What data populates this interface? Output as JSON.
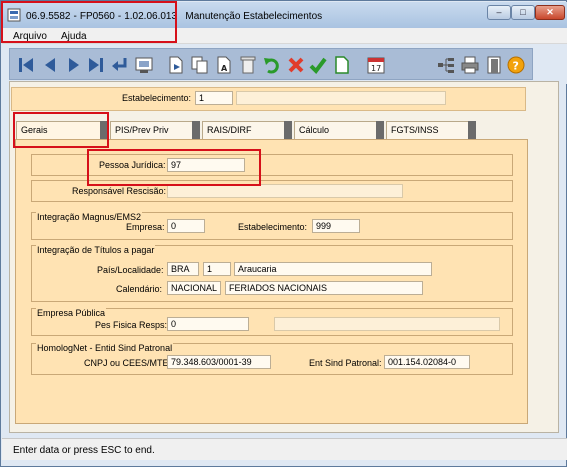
{
  "window": {
    "code": "06.9.5582",
    "program": "FP0560",
    "version": "1.02.06.013",
    "title": "Manutenção Estabelecimentos",
    "buttons": {
      "minimize": "–",
      "maximize": "□",
      "close": "✕"
    }
  },
  "menu": {
    "items": [
      "Arquivo",
      "Ajuda"
    ]
  },
  "toolbar": {
    "icons": [
      "first-record-icon",
      "previous-record-icon",
      "next-record-icon",
      "last-record-icon",
      "go-to-icon",
      "search-icon",
      "new-icon",
      "copy-icon",
      "edit-icon",
      "delete-icon",
      "undo-icon",
      "cancel-icon",
      "save-icon",
      "new-document-icon",
      "calendar-icon",
      "tree-icon",
      "print-icon",
      "exit-icon",
      "help-icon"
    ],
    "calendar_day": "17",
    "help_glyph": "?"
  },
  "header": {
    "estabelecimento_label": "Estabelecimento:",
    "estabelecimento_value": "1"
  },
  "tabs": [
    {
      "label": "Gerais",
      "active": true
    },
    {
      "label": "PIS/Prev Priv"
    },
    {
      "label": "RAIS/DIRF"
    },
    {
      "label": "Cálculo"
    },
    {
      "label": "FGTS/INSS"
    }
  ],
  "gerais": {
    "pessoa_juridica_label": "Pessoa Jurídica:",
    "pessoa_juridica_value": "97",
    "responsavel_label": "Responsável Rescisão:",
    "responsavel_value": "",
    "magnus": {
      "title": "Integração Magnus/EMS2",
      "empresa_label": "Empresa:",
      "empresa_value": "0",
      "estab_label": "Estabelecimento:",
      "estab_value": "999"
    },
    "titulos": {
      "title": "Integração de Títulos a pagar",
      "pais_label": "País/Localidade:",
      "pais_value": "BRA",
      "localidade_value": "1",
      "localidade_name": "Araucaria",
      "calendario_label": "Calendário:",
      "calendario_value": "NACIONAL",
      "calendario_desc": "FERIADOS NACIONAIS"
    },
    "publica": {
      "title": "Empresa Pública",
      "pes_fisica_label": "Pes Fisica Resps:",
      "pes_fisica_value": "0"
    },
    "homolognet": {
      "title": "HomologNet - Entid Sind Patronal",
      "cnpj_label": "CNPJ ou CEES/MTE:",
      "cnpj_value": "79.348.603/0001-39",
      "ent_label": "Ent Sind Patronal:",
      "ent_value": "001.154.02084-0"
    }
  },
  "status": {
    "text": "Enter data or press ESC to end."
  },
  "colors": {
    "panel": "#ffe3b3",
    "highlight": "#d6101a",
    "toolbar": "#a9bcd6"
  }
}
